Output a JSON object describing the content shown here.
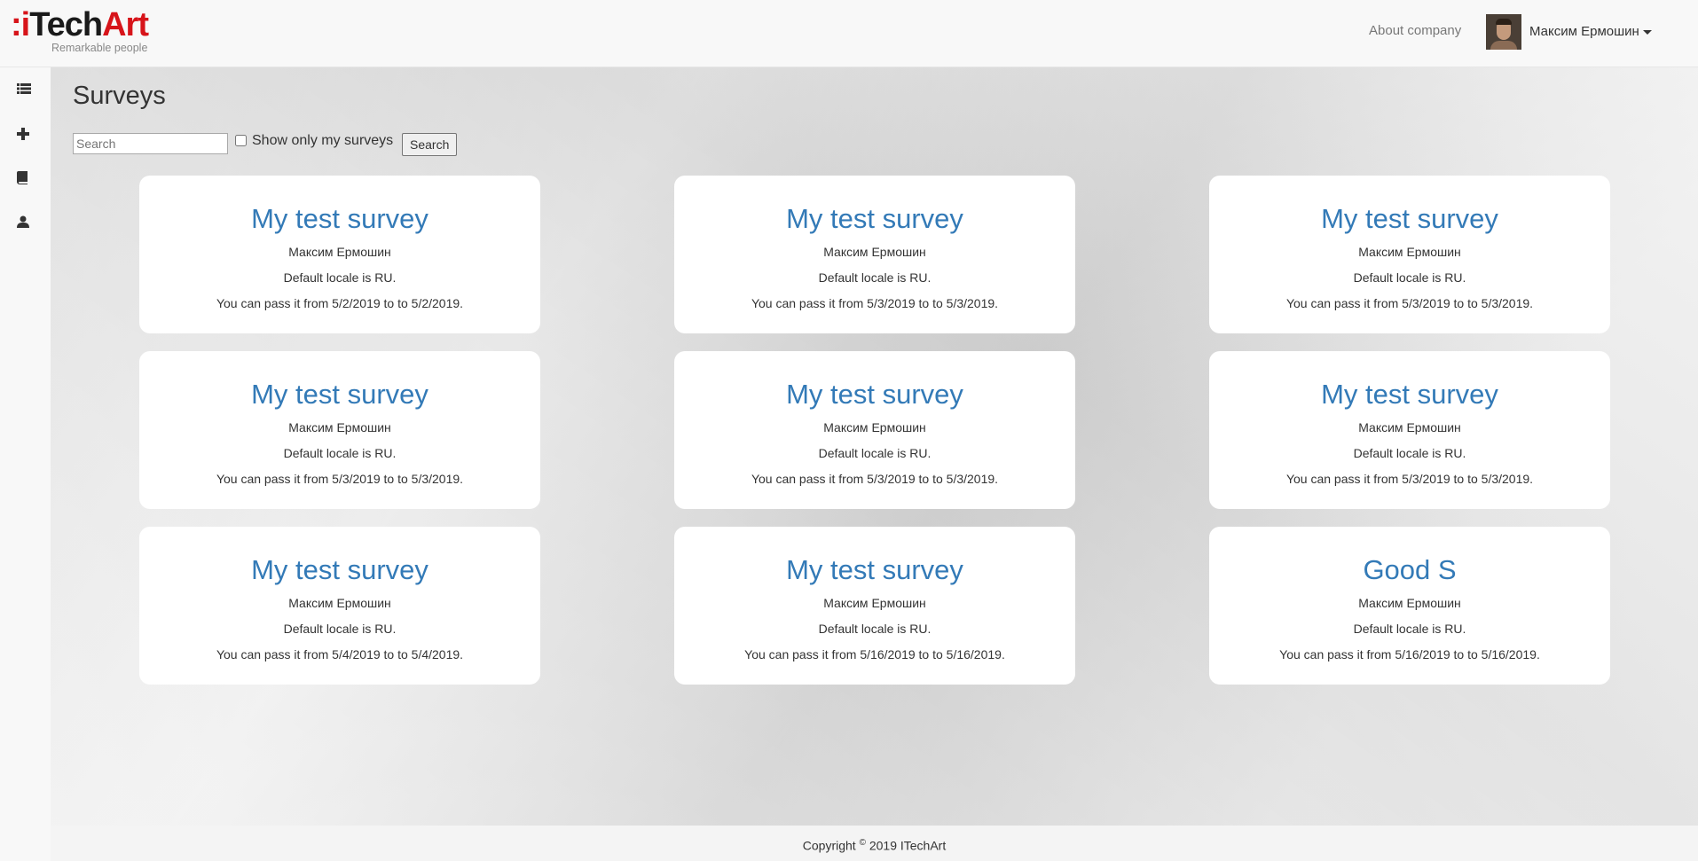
{
  "header": {
    "logo_mark": ":iTechArt",
    "logo_tagline": "Remarkable people",
    "about_label": "About company",
    "user_name": "Максим Ермошин"
  },
  "sidebar": {
    "items": [
      {
        "icon": "list-icon"
      },
      {
        "icon": "plus-icon"
      },
      {
        "icon": "book-icon"
      },
      {
        "icon": "user-icon"
      }
    ]
  },
  "main": {
    "title": "Surveys",
    "search_placeholder": "Search",
    "search_value": "",
    "only_mine_label": "Show only my surveys",
    "only_mine_checked": false,
    "search_button": "Search"
  },
  "surveys": [
    {
      "title": "My test survey",
      "author": "Максим Ермошин",
      "locale": "Default locale is RU.",
      "dates": "You can pass it from 5/2/2019 to to 5/2/2019."
    },
    {
      "title": "My test survey",
      "author": "Максим Ермошин",
      "locale": "Default locale is RU.",
      "dates": "You can pass it from 5/3/2019 to to 5/3/2019."
    },
    {
      "title": "My test survey",
      "author": "Максим Ермошин",
      "locale": "Default locale is RU.",
      "dates": "You can pass it from 5/3/2019 to to 5/3/2019."
    },
    {
      "title": "My test survey",
      "author": "Максим Ермошин",
      "locale": "Default locale is RU.",
      "dates": "You can pass it from 5/3/2019 to to 5/3/2019."
    },
    {
      "title": "My test survey",
      "author": "Максим Ермошин",
      "locale": "Default locale is RU.",
      "dates": "You can pass it from 5/3/2019 to to 5/3/2019."
    },
    {
      "title": "My test survey",
      "author": "Максим Ермошин",
      "locale": "Default locale is RU.",
      "dates": "You can pass it from 5/3/2019 to to 5/3/2019."
    },
    {
      "title": "My test survey",
      "author": "Максим Ермошин",
      "locale": "Default locale is RU.",
      "dates": "You can pass it from 5/4/2019 to to 5/4/2019."
    },
    {
      "title": "My test survey",
      "author": "Максим Ермошин",
      "locale": "Default locale is RU.",
      "dates": "You can pass it from 5/16/2019 to to 5/16/2019."
    },
    {
      "title": "Good S",
      "author": "Максим Ермошин",
      "locale": "Default locale is RU.",
      "dates": "You can pass it from 5/16/2019 to to 5/16/2019."
    }
  ],
  "footer": {
    "copyright_prefix": "Copyright",
    "copyright_symbol": "©",
    "copyright_suffix": "2019 ITechArt"
  },
  "colors": {
    "brand_red": "#d7141a",
    "link_blue": "#337ab7"
  }
}
